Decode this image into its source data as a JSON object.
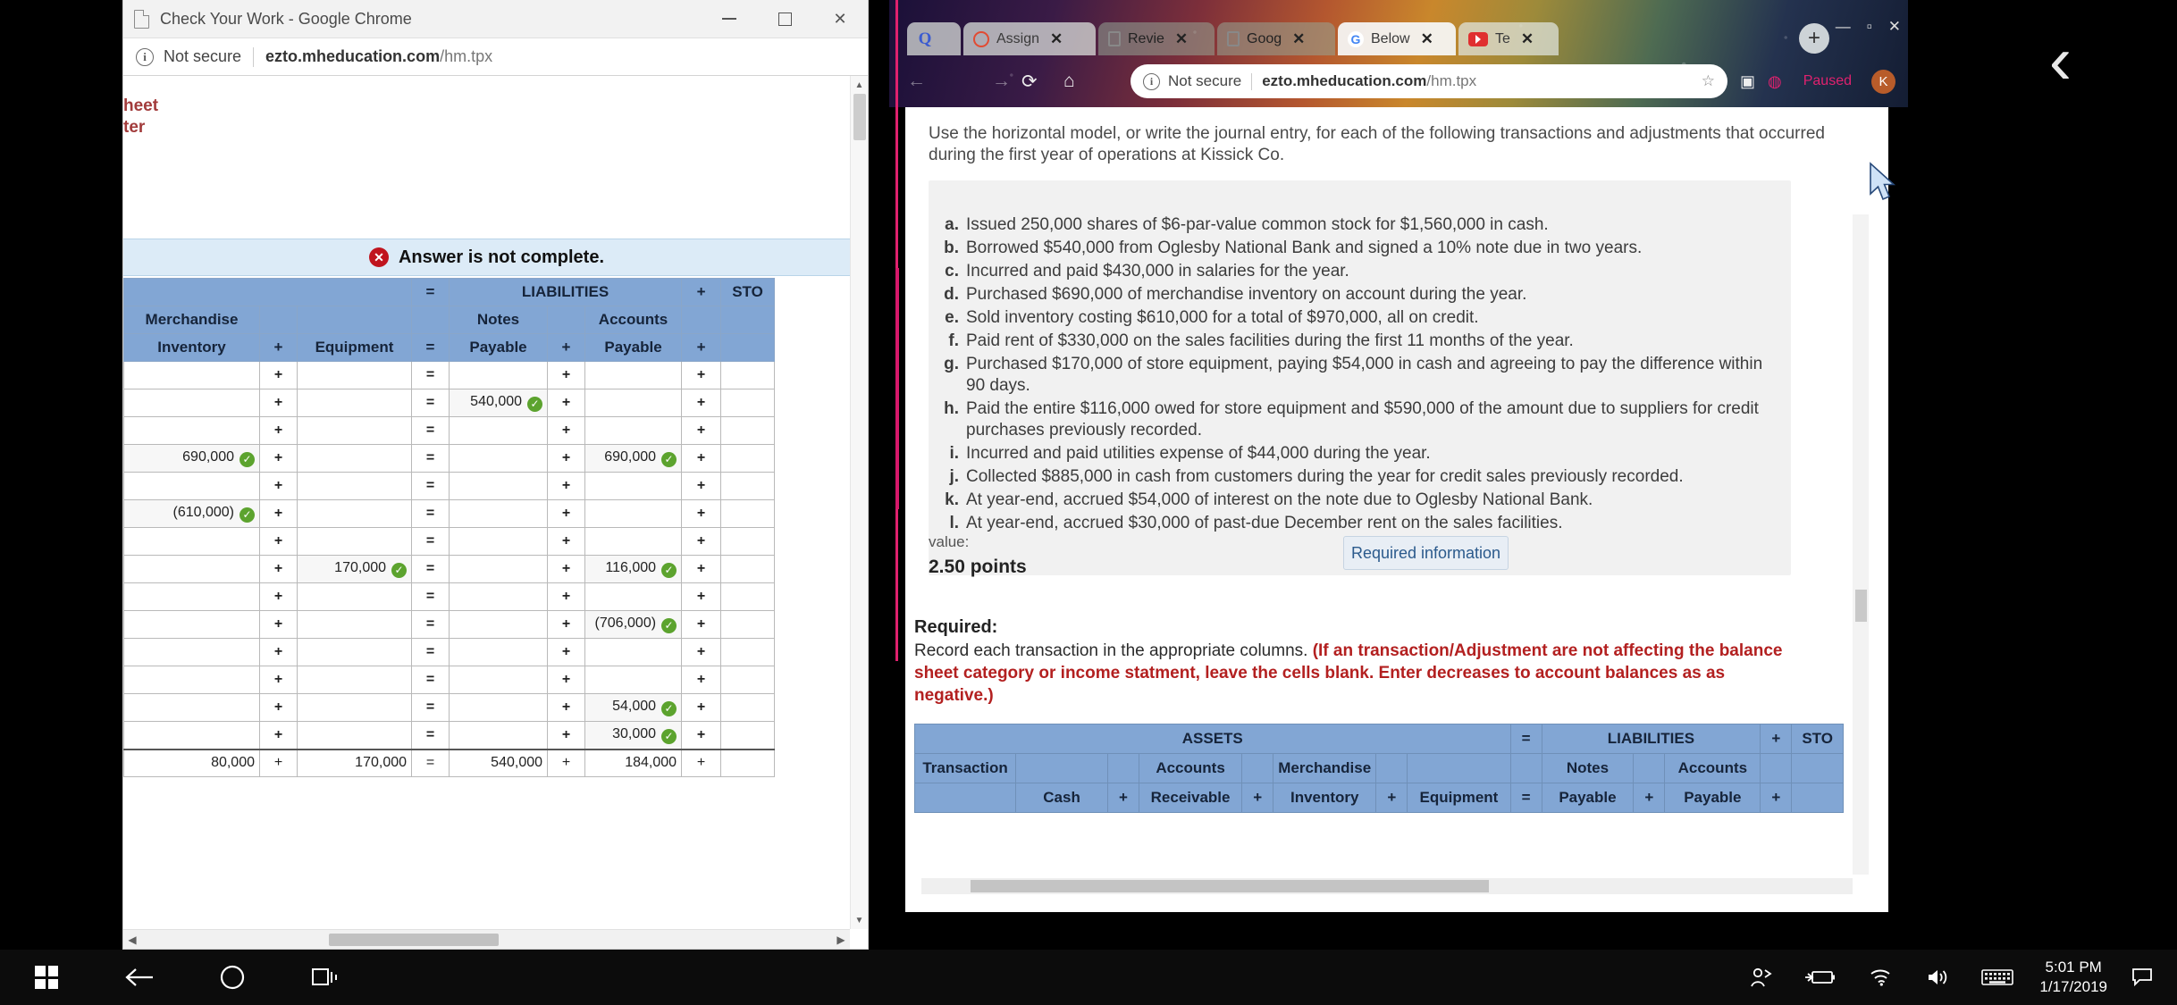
{
  "left_window": {
    "title": "Check Your Work - Google Chrome",
    "icons": {
      "doc": "document-icon",
      "minimize": "minimize-icon",
      "maximize": "maximize-icon",
      "close": "close-icon"
    },
    "address": {
      "security_label": "Not secure",
      "domain": "ezto.mheducation.com",
      "path": "/hm.tpx"
    },
    "page_header_lines": [
      "heet",
      "ter"
    ],
    "notice": {
      "text": "Answer is not complete.",
      "badge": "x"
    },
    "table": {
      "group_headers": [
        "",
        "=",
        "LIABILITIES",
        "+",
        "STO"
      ],
      "sub_headers_row1": [
        "Merchandise",
        "",
        "",
        "",
        "Notes",
        "",
        "Accounts",
        ""
      ],
      "sub_headers_row2": [
        "Inventory",
        "+",
        "Equipment",
        "=",
        "Payable",
        "+",
        "Payable",
        "+"
      ],
      "rows": [
        {
          "inventory": "",
          "equipment": "",
          "notes": "",
          "accounts": "",
          "chk_inv": false,
          "chk_eq": false,
          "chk_np": false,
          "chk_ap": false
        },
        {
          "inventory": "",
          "equipment": "",
          "notes": "540,000",
          "accounts": "",
          "chk_inv": false,
          "chk_eq": false,
          "chk_np": true,
          "chk_ap": false
        },
        {
          "inventory": "",
          "equipment": "",
          "notes": "",
          "accounts": "",
          "chk_inv": false,
          "chk_eq": false,
          "chk_np": false,
          "chk_ap": false
        },
        {
          "inventory": "690,000",
          "equipment": "",
          "notes": "",
          "accounts": "690,000",
          "chk_inv": true,
          "chk_eq": false,
          "chk_np": false,
          "chk_ap": true
        },
        {
          "inventory": "",
          "equipment": "",
          "notes": "",
          "accounts": "",
          "chk_inv": false,
          "chk_eq": false,
          "chk_np": false,
          "chk_ap": false
        },
        {
          "inventory": "(610,000)",
          "equipment": "",
          "notes": "",
          "accounts": "",
          "chk_inv": true,
          "chk_eq": false,
          "chk_np": false,
          "chk_ap": false
        },
        {
          "inventory": "",
          "equipment": "",
          "notes": "",
          "accounts": "",
          "chk_inv": false,
          "chk_eq": false,
          "chk_np": false,
          "chk_ap": false
        },
        {
          "inventory": "",
          "equipment": "170,000",
          "notes": "",
          "accounts": "116,000",
          "chk_inv": false,
          "chk_eq": true,
          "chk_np": false,
          "chk_ap": true
        },
        {
          "inventory": "",
          "equipment": "",
          "notes": "",
          "accounts": "",
          "chk_inv": false,
          "chk_eq": false,
          "chk_np": false,
          "chk_ap": false
        },
        {
          "inventory": "",
          "equipment": "",
          "notes": "",
          "accounts": "(706,000)",
          "chk_inv": false,
          "chk_eq": false,
          "chk_np": false,
          "chk_ap": true
        },
        {
          "inventory": "",
          "equipment": "",
          "notes": "",
          "accounts": "",
          "chk_inv": false,
          "chk_eq": false,
          "chk_np": false,
          "chk_ap": false
        },
        {
          "inventory": "",
          "equipment": "",
          "notes": "",
          "accounts": "",
          "chk_inv": false,
          "chk_eq": false,
          "chk_np": false,
          "chk_ap": false
        },
        {
          "inventory": "",
          "equipment": "",
          "notes": "",
          "accounts": "54,000",
          "chk_inv": false,
          "chk_eq": false,
          "chk_np": false,
          "chk_ap": true
        },
        {
          "inventory": "",
          "equipment": "",
          "notes": "",
          "accounts": "30,000",
          "chk_inv": false,
          "chk_eq": false,
          "chk_np": false,
          "chk_ap": true
        }
      ],
      "total_row": {
        "inventory": "80,000",
        "equipment": "170,000",
        "notes": "540,000",
        "accounts": "184,000"
      }
    }
  },
  "right_window": {
    "tabs": [
      {
        "label": "",
        "favicon": "q-icon",
        "closable": false
      },
      {
        "label": "Assign",
        "favicon": "circle-icon",
        "closable": true
      },
      {
        "label": "Revie",
        "favicon": "document-icon",
        "closable": true
      },
      {
        "label": "Goog",
        "favicon": "document-icon",
        "closable": true
      },
      {
        "label": "Below",
        "favicon": "google-icon",
        "closable": true
      },
      {
        "label": "Te",
        "favicon": "youtube-icon",
        "closable": true
      }
    ],
    "new_tab_label": "+",
    "win_controls": [
      "minimize-icon",
      "maximize-icon",
      "close-icon"
    ],
    "address": {
      "security_label": "Not secure",
      "domain": "ezto.mheducation.com",
      "path": "/hm.tpx",
      "paused_label": "Paused",
      "avatar_letter": "K"
    },
    "intro": "Use the horizontal model, or write the journal entry, for each of the following transactions and adjustments that occurred during the first year of operations at Kissick Co.",
    "transactions": [
      {
        "letter": "a.",
        "text": "Issued 250,000 shares of $6-par-value common stock for $1,560,000 in cash."
      },
      {
        "letter": "b.",
        "text": "Borrowed $540,000 from Oglesby National Bank and signed a 10% note due in two years."
      },
      {
        "letter": "c.",
        "text": "Incurred and paid $430,000 in salaries for the year."
      },
      {
        "letter": "d.",
        "text": "Purchased $690,000 of merchandise inventory on account during the year."
      },
      {
        "letter": "e.",
        "text": "Sold inventory costing $610,000 for a total of $970,000, all on credit."
      },
      {
        "letter": "f.",
        "text": "Paid rent of $330,000 on the sales facilities during the first 11 months of the year."
      },
      {
        "letter": "g.",
        "text": "Purchased $170,000 of store equipment, paying $54,000 in cash and agreeing to pay the difference within 90 days."
      },
      {
        "letter": "h.",
        "text": "Paid the entire $116,000 owed for store equipment and $590,000 of the amount due to suppliers for credit purchases previously recorded."
      },
      {
        "letter": "i.",
        "text": "Incurred and paid utilities expense of $44,000 during the year."
      },
      {
        "letter": "j.",
        "text": "Collected $885,000 in cash from customers during the year for credit sales previously recorded."
      },
      {
        "letter": "k.",
        "text": "At year-end, accrued $54,000 of interest on the note due to Oglesby National Bank."
      },
      {
        "letter": "l.",
        "text": "At year-end, accrued $30,000 of past-due December rent on the sales facilities."
      }
    ],
    "value_label": "value:",
    "value_points": "2.50 points",
    "required_info_button": "Required information",
    "required_title": "Required:",
    "required_body": "Record each transaction in the appropriate columns.",
    "required_red": "(If an transaction/Adjustment are not affecting the balance sheet category or income statment, leave the cells blank. Enter decreases to account balances as as negative.)",
    "table": {
      "group_headers": [
        "ASSETS",
        "=",
        "LIABILITIES",
        "+",
        "STO"
      ],
      "sub1": [
        "Transaction",
        "",
        "Accounts",
        "Merchandise",
        "",
        "",
        "Notes",
        "",
        "Accounts",
        ""
      ],
      "sub2": [
        "",
        "Cash",
        "+",
        "Receivable",
        "+",
        "Inventory",
        "+",
        "Equipment",
        "=",
        "Payable",
        "+",
        "Payable",
        "+"
      ]
    }
  },
  "taskbar": {
    "start": "windows-logo-icon",
    "items": [
      "back-arrow-icon",
      "cortana-circle-icon",
      "task-view-icon"
    ],
    "tray": [
      "people-icon",
      "battery-icon",
      "wifi-icon",
      "volume-icon",
      "keyboard-icon"
    ],
    "time": "5:01 PM",
    "date": "1/17/2019",
    "action_center": "action-center-icon"
  },
  "overlay": {
    "back_chevron": "‹"
  }
}
